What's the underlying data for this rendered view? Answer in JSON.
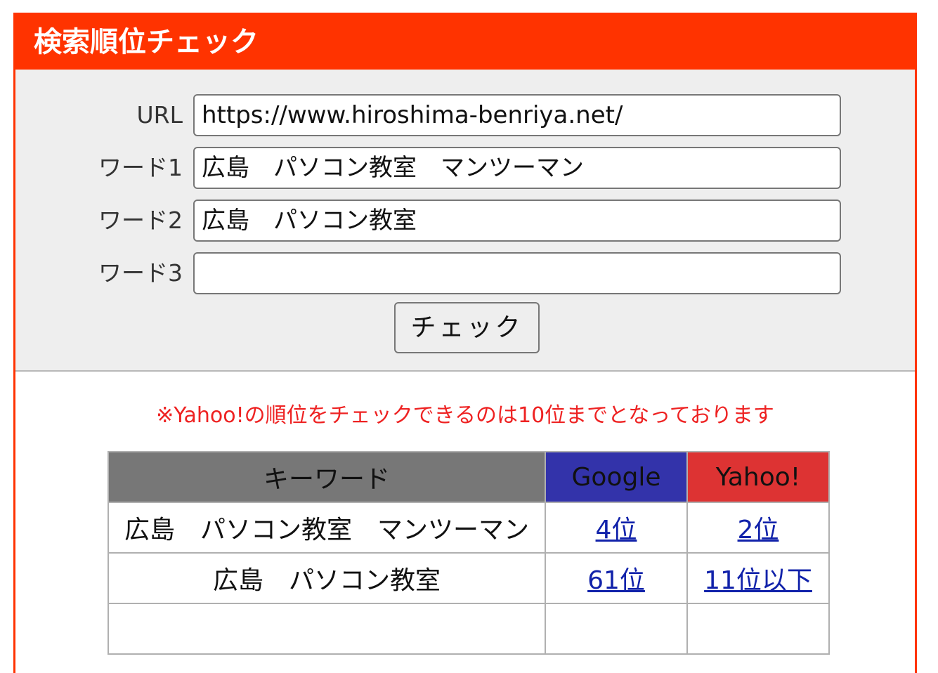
{
  "header": {
    "title": "検索順位チェック"
  },
  "form": {
    "url_label": "URL",
    "url_value": "https://www.hiroshima-benriya.net/",
    "word1_label": "ワード1",
    "word1_value": "広島　パソコン教室　マンツーマン",
    "word2_label": "ワード2",
    "word2_value": "広島　パソコン教室",
    "word3_label": "ワード3",
    "word3_value": "",
    "check_button": "チェック"
  },
  "notice": "※Yahoo!の順位をチェックできるのは10位までとなっております",
  "table": {
    "headers": [
      "キーワード",
      "Google",
      "Yahoo!"
    ],
    "rows": [
      {
        "keyword": "広島　パソコン教室　マンツーマン",
        "google": "4位",
        "yahoo": "2位"
      },
      {
        "keyword": "広島　パソコン教室",
        "google": "61位",
        "yahoo": "11位以下"
      },
      {
        "keyword": "",
        "google": "",
        "yahoo": ""
      }
    ]
  },
  "colors": {
    "accent": "#ff3300",
    "google_header": "#3333aa",
    "yahoo_header": "#dd3333",
    "keyword_header": "#777777",
    "notice_text": "#ee2222",
    "link": "#1122aa"
  }
}
